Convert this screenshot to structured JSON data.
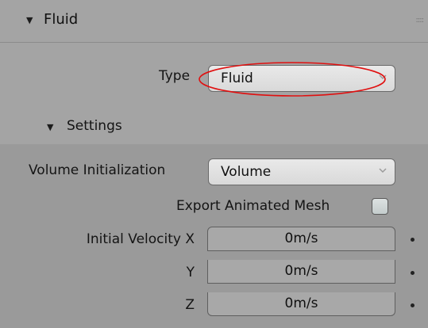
{
  "panel": {
    "title": "Fluid",
    "grip": "::::"
  },
  "fluid_type": {
    "label": "Type",
    "value": "Fluid"
  },
  "settings": {
    "title": "Settings",
    "volume_init": {
      "label": "Volume Initialization",
      "value": "Volume"
    },
    "export_mesh": {
      "label": "Export Animated Mesh",
      "checked": false
    },
    "velocity": {
      "x_label": "Initial Velocity X",
      "y_label": "Y",
      "z_label": "Z",
      "x_value": "0m/s",
      "y_value": "0m/s",
      "z_value": "0m/s"
    }
  },
  "annotation": {
    "color": "#e01010"
  },
  "icons": {
    "expand": "triangle-down",
    "dropdown": "chevron-down",
    "grip": "drag-handle",
    "keyframe": "dot"
  }
}
